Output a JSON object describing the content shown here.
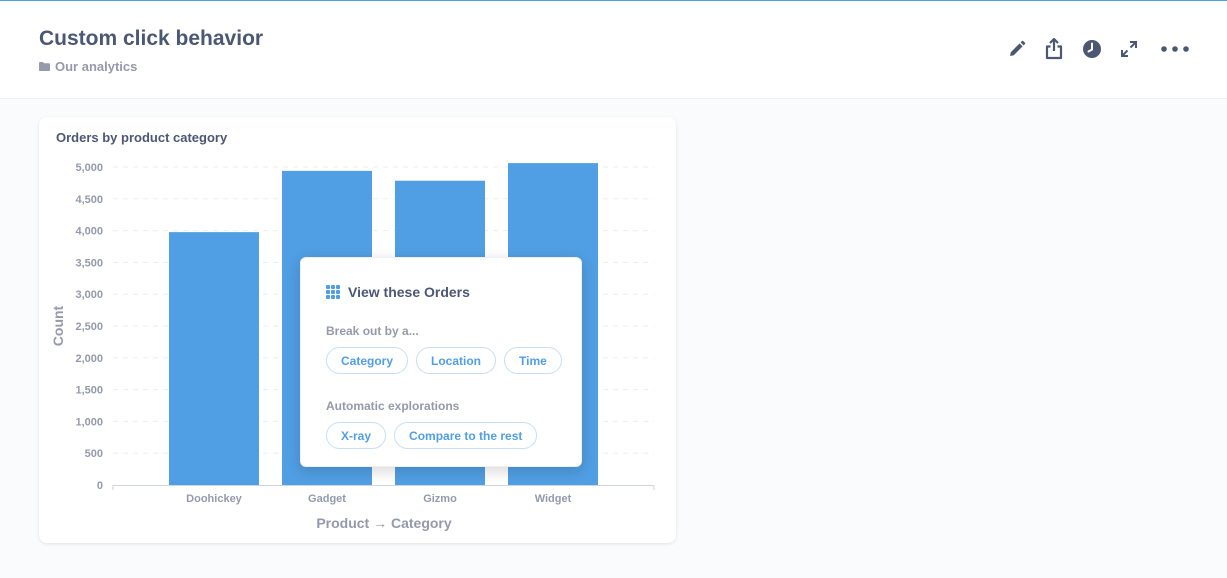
{
  "header": {
    "title": "Custom click behavior",
    "collection": "Our analytics"
  },
  "actions": [
    {
      "icon": "pencil-icon",
      "label": "edit"
    },
    {
      "icon": "share-icon",
      "label": "share"
    },
    {
      "icon": "clock-icon",
      "label": "history"
    },
    {
      "icon": "fullscreen-icon",
      "label": "fullscreen"
    },
    {
      "icon": "ellipsis-icon",
      "label": "more"
    }
  ],
  "card": {
    "title": "Orders by product category"
  },
  "chart_data": {
    "type": "bar",
    "categories": [
      "Doohickey",
      "Gadget",
      "Gizmo",
      "Widget"
    ],
    "values": [
      3976,
      4939,
      4784,
      5061
    ],
    "xlabel": "Product → Category",
    "ylabel": "Count",
    "ylim": [
      0,
      5000
    ],
    "yticks": [
      "0",
      "500",
      "1,000",
      "1,500",
      "2,000",
      "2,500",
      "3,000",
      "3,500",
      "4,000",
      "4,500",
      "5,000"
    ],
    "grid": true,
    "color": "#509ee3"
  },
  "popover": {
    "head": "View these Orders",
    "breakout_label": "Break out by a...",
    "breakout_options": [
      "Category",
      "Location",
      "Time"
    ],
    "auto_label": "Automatic explorations",
    "auto_options": [
      "X-ray",
      "Compare to the rest"
    ]
  },
  "colors": {
    "accent": "#509ee3",
    "text": "#4c5773",
    "muted": "#949aab"
  }
}
